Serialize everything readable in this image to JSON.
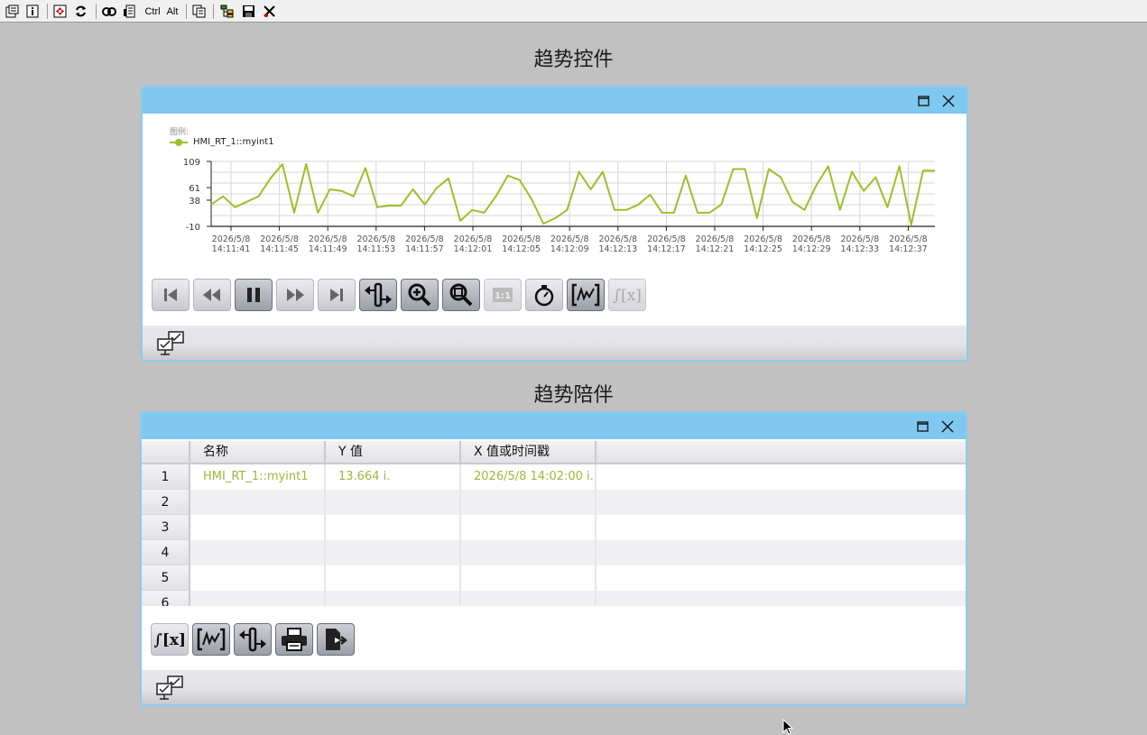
{
  "toolbar": {
    "ctrl_label": "Ctrl",
    "alt_label": "Alt"
  },
  "trend": {
    "title": "趋势控件",
    "legend_title": "图例:",
    "series_name": "HMI_RT_1::myint1",
    "y_ticks": [
      "109",
      "61",
      "38",
      "-10"
    ],
    "x_ticks": [
      {
        "date": "2026/5/8",
        "time": "14:11:41"
      },
      {
        "date": "2026/5/8",
        "time": "14:11:45"
      },
      {
        "date": "2026/5/8",
        "time": "14:11:49"
      },
      {
        "date": "2026/5/8",
        "time": "14:11:53"
      },
      {
        "date": "2026/5/8",
        "time": "14:11:57"
      },
      {
        "date": "2026/5/8",
        "time": "14:12:01"
      },
      {
        "date": "2026/5/8",
        "time": "14:12:05"
      },
      {
        "date": "2026/5/8",
        "time": "14:12:09"
      },
      {
        "date": "2026/5/8",
        "time": "14:12:13"
      },
      {
        "date": "2026/5/8",
        "time": "14:12:17"
      },
      {
        "date": "2026/5/8",
        "time": "14:12:21"
      },
      {
        "date": "2026/5/8",
        "time": "14:12:25"
      },
      {
        "date": "2026/5/8",
        "time": "14:12:29"
      },
      {
        "date": "2026/5/8",
        "time": "14:12:33"
      },
      {
        "date": "2026/5/8",
        "time": "14:12:37"
      }
    ],
    "series_color": "#9cc028"
  },
  "chart_data": {
    "type": "line",
    "title": "",
    "xlabel": "",
    "ylabel": "",
    "ylim": [
      -10,
      109
    ],
    "grid": true,
    "legend": "top-left",
    "x": [
      "14:11:40",
      "14:11:41",
      "14:11:42",
      "14:11:43",
      "14:11:44",
      "14:11:45",
      "14:11:46",
      "14:11:47",
      "14:11:48",
      "14:11:49",
      "14:11:50",
      "14:11:51",
      "14:11:52",
      "14:11:53",
      "14:11:54",
      "14:11:55",
      "14:11:56",
      "14:11:57",
      "14:11:58",
      "14:11:59",
      "14:12:00",
      "14:12:01",
      "14:12:02",
      "14:12:03",
      "14:12:04",
      "14:12:05",
      "14:12:06",
      "14:12:07",
      "14:12:08",
      "14:12:09",
      "14:12:10",
      "14:12:11",
      "14:12:12",
      "14:12:13",
      "14:12:14",
      "14:12:15",
      "14:12:16",
      "14:12:17",
      "14:12:18",
      "14:12:19",
      "14:12:20",
      "14:12:21",
      "14:12:22",
      "14:12:23",
      "14:12:24",
      "14:12:25",
      "14:12:26",
      "14:12:27",
      "14:12:28",
      "14:12:29",
      "14:12:30",
      "14:12:31",
      "14:12:32",
      "14:12:33",
      "14:12:34",
      "14:12:35",
      "14:12:36",
      "14:12:37",
      "14:12:38",
      "14:12:39"
    ],
    "series": [
      {
        "name": "HMI_RT_1::myint1",
        "values": [
          30,
          45,
          25,
          35,
          45,
          78,
          104,
          15,
          104,
          15,
          58,
          55,
          45,
          97,
          25,
          28,
          28,
          58,
          30,
          60,
          78,
          0,
          20,
          15,
          45,
          83,
          75,
          40,
          -5,
          5,
          20,
          90,
          58,
          90,
          20,
          20,
          30,
          48,
          15,
          15,
          83,
          15,
          15,
          30,
          95,
          95,
          5,
          95,
          80,
          35,
          20,
          65,
          100,
          20,
          90,
          55,
          80,
          25,
          100,
          -7,
          92,
          92
        ]
      }
    ]
  },
  "companion": {
    "title": "趋势陪伴",
    "columns": [
      "名称",
      "Y 值",
      "X 值或时间戳"
    ],
    "rows": [
      {
        "num": "1",
        "name": "HMI_RT_1::myint1",
        "y": "13.664 i.",
        "x": "2026/5/8 14:02:00 i."
      },
      {
        "num": "2",
        "name": "",
        "y": "",
        "x": ""
      },
      {
        "num": "3",
        "name": "",
        "y": "",
        "x": ""
      },
      {
        "num": "4",
        "name": "",
        "y": "",
        "x": ""
      },
      {
        "num": "5",
        "name": "",
        "y": "",
        "x": ""
      },
      {
        "num": "6",
        "name": "",
        "y": "",
        "x": ""
      }
    ]
  }
}
